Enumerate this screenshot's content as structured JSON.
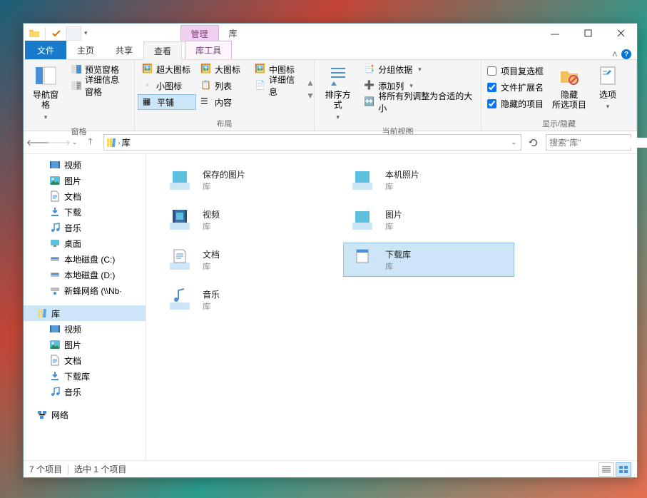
{
  "window": {
    "contextual_tab": "管理",
    "title": "库",
    "minimize": "—",
    "maximize": "▢",
    "close": "✕"
  },
  "tabs": {
    "file": "文件",
    "home": "主页",
    "share": "共享",
    "view": "查看",
    "lib": "库工具"
  },
  "ribbon": {
    "panes": {
      "nav": "导航窗格",
      "preview": "预览窗格",
      "details": "详细信息窗格",
      "group_label": "窗格"
    },
    "layout": {
      "xlarge": "超大图标",
      "large": "大图标",
      "medium": "中图标",
      "small": "小图标",
      "list": "列表",
      "details": "详细信息",
      "tiles": "平铺",
      "content": "内容",
      "group_label": "布局"
    },
    "currentview": {
      "sort": "排序方式",
      "groupby": "分组依据",
      "addcol": "添加列",
      "autosize": "将所有列调整为合适的大小",
      "group_label": "当前视图"
    },
    "showhide": {
      "checkboxes": "项目复选框",
      "ext": "文件扩展名",
      "hidden": "隐藏的项目",
      "hide_btn": "隐藏\n所选项目",
      "options": "选项",
      "group_label": "显示/隐藏"
    }
  },
  "address": {
    "path": "库",
    "chevron": "›",
    "search_placeholder": "搜索\"库\""
  },
  "tree": {
    "videos": "视频",
    "pictures": "图片",
    "documents": "文档",
    "downloads": "下载",
    "music": "音乐",
    "desktop": "桌面",
    "diskC": "本地磁盘 (C:)",
    "diskD": "本地磁盘 (D:)",
    "network_share": "新蜂网络 (\\\\Nb·",
    "libraries": "库",
    "lib_videos": "视频",
    "lib_pictures": "图片",
    "lib_documents": "文档",
    "lib_downloads": "下载库",
    "lib_music": "音乐",
    "network": "网络"
  },
  "items": [
    {
      "name": "保存的图片",
      "type": "库",
      "icon": "picture"
    },
    {
      "name": "本机照片",
      "type": "库",
      "icon": "picture"
    },
    {
      "name": "视频",
      "type": "库",
      "icon": "video"
    },
    {
      "name": "图片",
      "type": "库",
      "icon": "picture"
    },
    {
      "name": "文档",
      "type": "库",
      "icon": "document"
    },
    {
      "name": "下载库",
      "type": "库",
      "icon": "download",
      "selected": true
    },
    {
      "name": "音乐",
      "type": "库",
      "icon": "music"
    }
  ],
  "status": {
    "count": "7 个项目",
    "selection": "选中 1 个项目"
  }
}
